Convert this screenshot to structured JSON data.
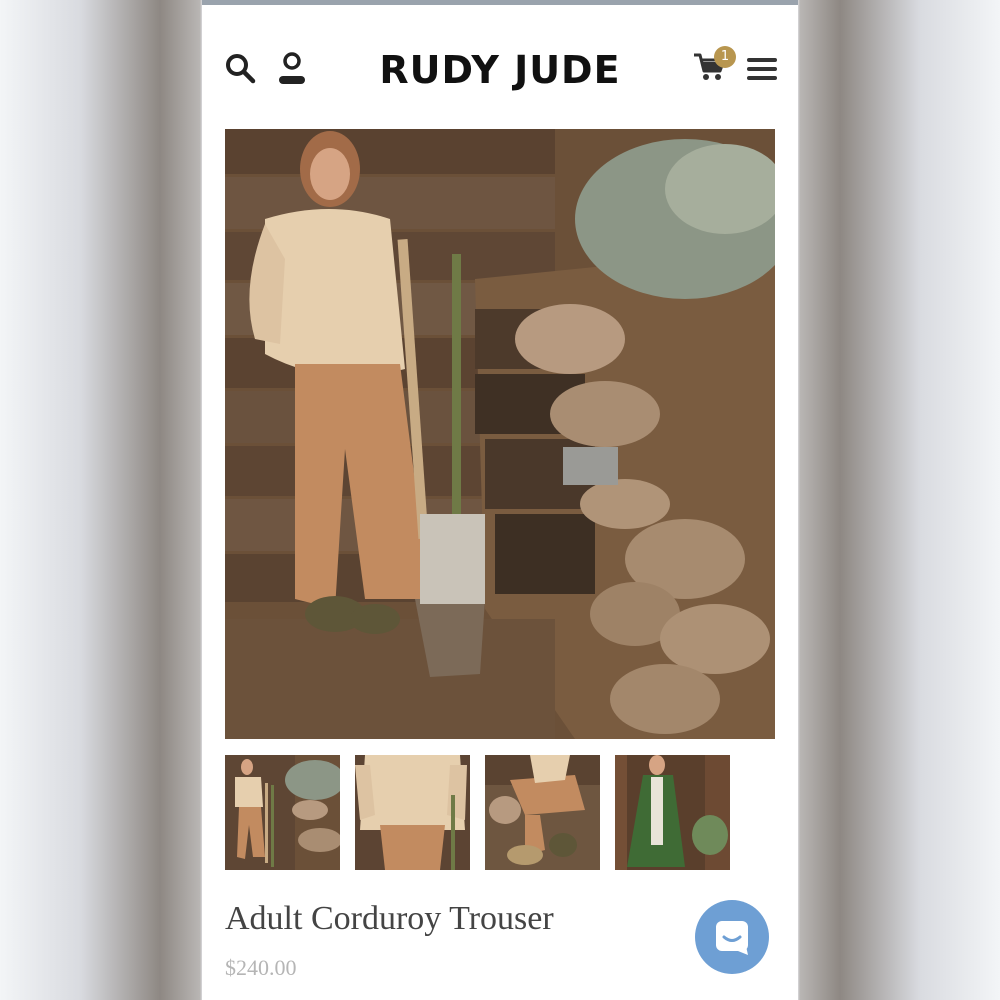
{
  "header": {
    "logo": "RUDY JUDE",
    "cart_count": "1",
    "icons": [
      "search-icon",
      "account-icon",
      "cart-icon",
      "menu-icon"
    ]
  },
  "gallery": {
    "thumbnail_count": 4
  },
  "product": {
    "title": "Adult Corduroy Trouser",
    "price": "$240.00"
  },
  "chat": {
    "icon": "chat-icon"
  },
  "colors": {
    "badge": "#b8964f",
    "chat": "#6e9fd4",
    "title": "#444444",
    "price": "#b5b5b5"
  }
}
